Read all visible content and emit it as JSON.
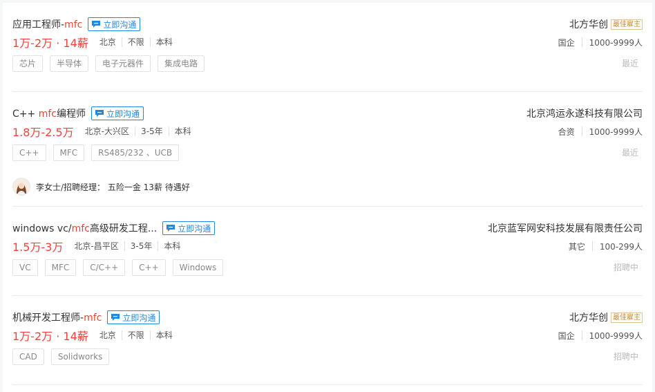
{
  "jobs": [
    {
      "title_pre": "应用工程师-",
      "title_kw": "mfc",
      "title_post": "",
      "chat_label": "立即沟通",
      "salary": "1万-2万 · 14薪",
      "meta": [
        "北京",
        "不限",
        "本科"
      ],
      "tags": [
        "芯片",
        "半导体",
        "电子元器件",
        "集成电路"
      ],
      "company": "北方华创",
      "badge": "最佳雇主",
      "company_info": [
        "国企",
        "1000-9999人"
      ],
      "status": "最近"
    },
    {
      "title_pre": "C++ ",
      "title_kw": "mfc",
      "title_post": "编程师",
      "chat_label": "立即沟通",
      "salary": "1.8万-2.5万",
      "meta": [
        "北京-大兴区",
        "3-5年",
        "本科"
      ],
      "tags": [
        "C++",
        "MFC",
        "RS485/232 、UCB"
      ],
      "company": "北京鸿运永遂科技有限公司",
      "company_info": [
        "合资",
        "1000-9999人"
      ],
      "status": "最近",
      "recruiter": "李女士/招聘经理： 五险一金 13薪 待遇好"
    },
    {
      "title_pre": "windows vc/",
      "title_kw": "mfc",
      "title_post": "高级研发工程...",
      "chat_label": "立即沟通",
      "salary": "1.5万-3万",
      "meta": [
        "北京-昌平区",
        "3-5年",
        "本科"
      ],
      "tags": [
        "VC",
        "MFC",
        "C/C++",
        "C++",
        "Windows"
      ],
      "company": "北京蓝军网安科技发展有限责任公司",
      "company_info": [
        "其它",
        "100-299人"
      ],
      "status": "招聘中"
    },
    {
      "title_pre": "机械开发工程师-",
      "title_kw": "mfc",
      "title_post": "",
      "chat_label": "立即沟通",
      "salary": "1万-2万 · 14薪",
      "meta": [
        "北京",
        "不限",
        "本科"
      ],
      "tags": [
        "CAD",
        "Solidworks"
      ],
      "company": "北方华创",
      "badge": "最佳雇主",
      "company_info": [
        "国企",
        "1000-9999人"
      ],
      "status": "招聘中"
    }
  ],
  "icons": {
    "chat": "chat-icon",
    "avatar": "female-avatar"
  },
  "colors": {
    "keyword": "#e6452f",
    "salary": "#f1413a",
    "chat": "#1e88e5",
    "badge": "#c58a38"
  }
}
